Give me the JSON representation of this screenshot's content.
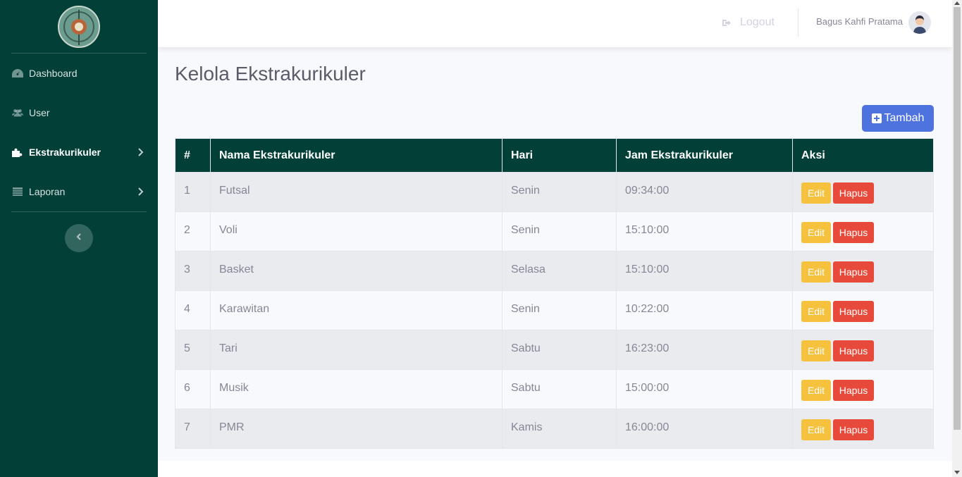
{
  "sidebar": {
    "items": [
      {
        "label": "Dashboard",
        "icon": "dashboard-icon",
        "active": false,
        "submenu": false
      },
      {
        "label": "User",
        "icon": "users-icon",
        "active": false,
        "submenu": false
      },
      {
        "label": "Ekstrakurikuler",
        "icon": "puzzle-icon",
        "active": true,
        "submenu": true
      },
      {
        "label": "Laporan",
        "icon": "table-icon",
        "active": false,
        "submenu": true
      }
    ]
  },
  "topbar": {
    "logout_label": "Logout",
    "username": "Bagus Kahfi Pratama"
  },
  "page": {
    "title": "Kelola Ekstrakurikuler",
    "add_label": "Tambah"
  },
  "table": {
    "headers": [
      "#",
      "Nama Ekstrakurikuler",
      "Hari",
      "Jam Ekstrakurikuler",
      "Aksi"
    ],
    "rows": [
      {
        "no": "1",
        "nama": "Futsal",
        "hari": "Senin",
        "jam": "09:34:00"
      },
      {
        "no": "2",
        "nama": "Voli",
        "hari": "Senin",
        "jam": "15:10:00"
      },
      {
        "no": "3",
        "nama": "Basket",
        "hari": "Selasa",
        "jam": "15:10:00"
      },
      {
        "no": "4",
        "nama": "Karawitan",
        "hari": "Senin",
        "jam": "10:22:00"
      },
      {
        "no": "5",
        "nama": "Tari",
        "hari": "Sabtu",
        "jam": "16:23:00"
      },
      {
        "no": "6",
        "nama": "Musik",
        "hari": "Sabtu",
        "jam": "15:00:00"
      },
      {
        "no": "7",
        "nama": "PMR",
        "hari": "Kamis",
        "jam": "16:00:00"
      }
    ],
    "edit_label": "Edit",
    "delete_label": "Hapus"
  },
  "colors": {
    "sidebar": "#013f37",
    "primary": "#4e73df",
    "warning": "#f6c23e",
    "danger": "#e74a3b"
  }
}
